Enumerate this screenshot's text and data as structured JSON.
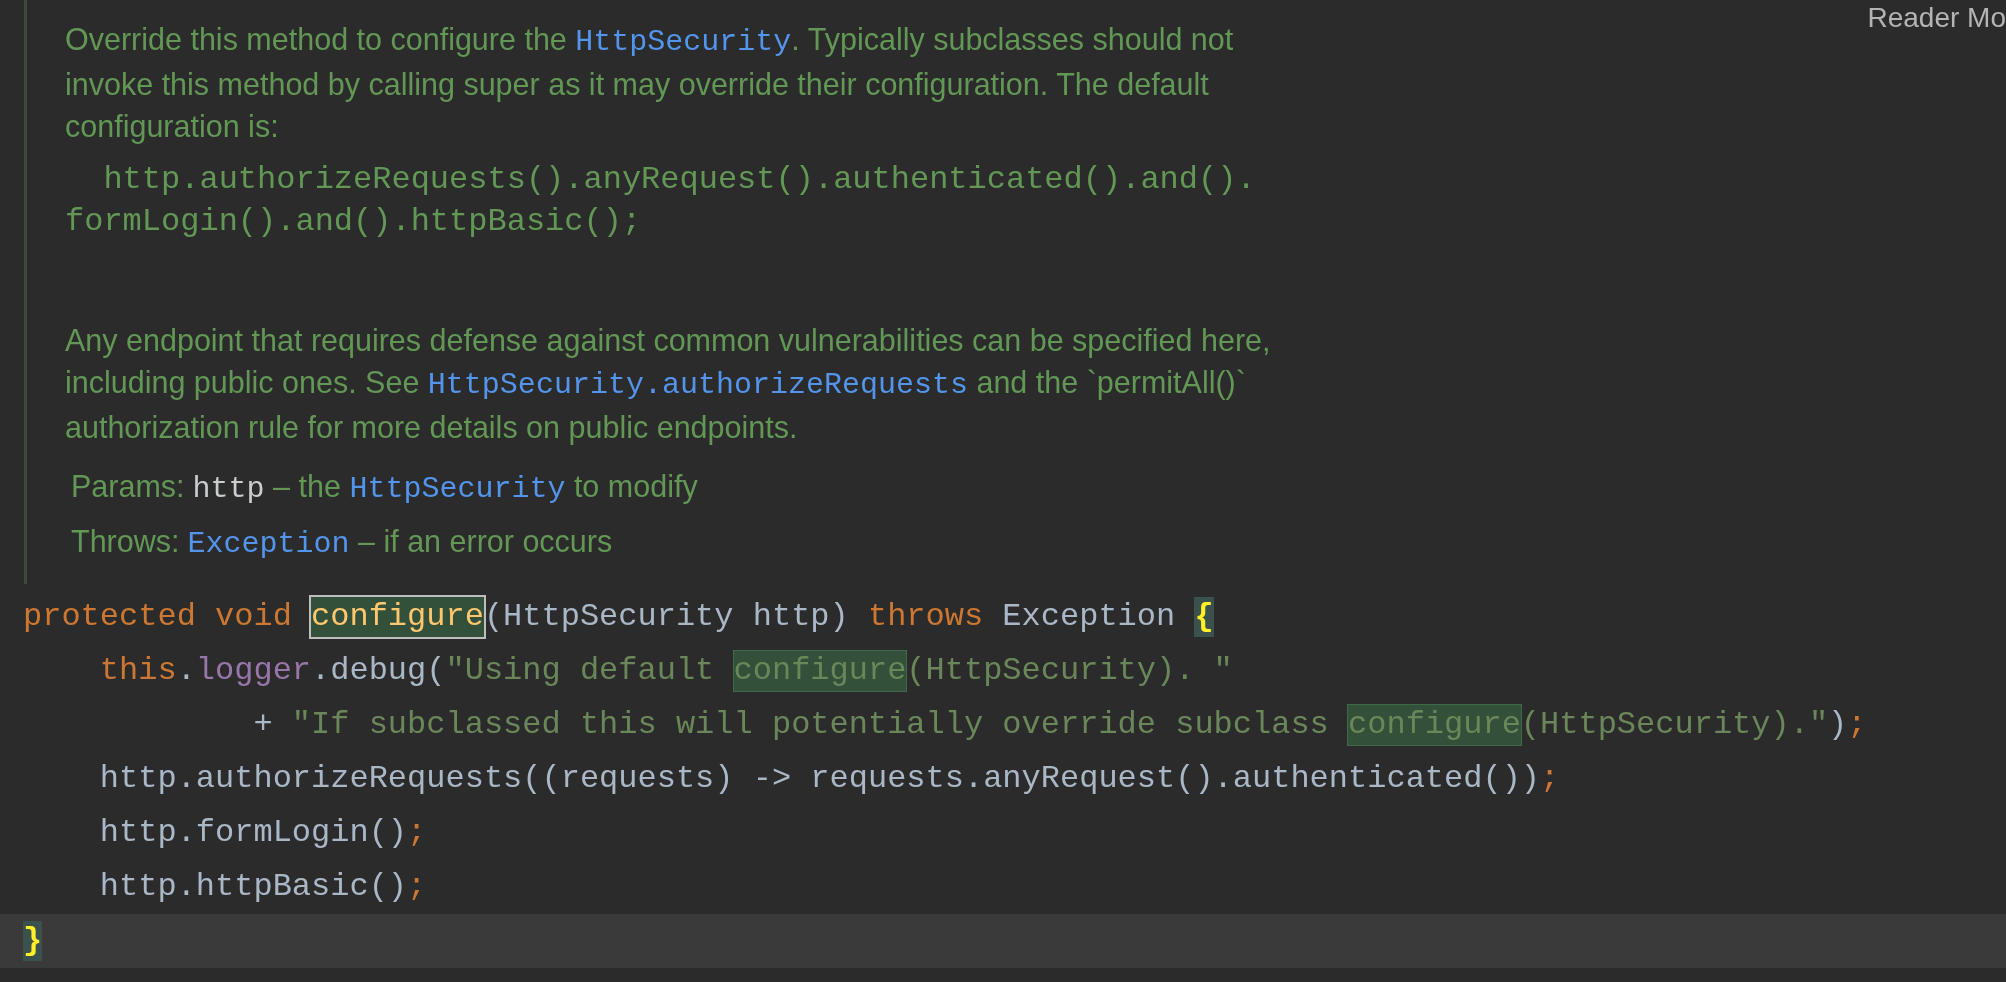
{
  "reader_mode": {
    "label": "Reader Mo"
  },
  "doc": {
    "paragraphs": [
      {
        "kind": "prose",
        "segments": [
          {
            "kind": "text",
            "text": "Override this method to configure the "
          },
          {
            "kind": "link",
            "text": "HttpSecurity"
          },
          {
            "kind": "text",
            "text": ". Typically subclasses should not invoke this method by calling super as it may override their configuration. The default configuration is:"
          }
        ]
      },
      {
        "kind": "code",
        "segments": [
          {
            "kind": "text",
            "text": "  http.authorizeRequests().anyRequest().authenticated().and().formLogin().and().httpBasic();"
          }
        ]
      },
      {
        "kind": "prose",
        "segments": [
          {
            "kind": "text",
            "text": "Any endpoint that requires defense against common vulnerabilities can be specified here, including public ones. See "
          },
          {
            "kind": "link",
            "text": "HttpSecurity.authorizeRequests"
          },
          {
            "kind": "text",
            "text": " and the `permitAll()` authorization rule for more details on public endpoints."
          }
        ]
      }
    ],
    "tags": [
      {
        "label": "Params:",
        "segments": [
          {
            "kind": "param",
            "text": "http"
          },
          {
            "kind": "text",
            "text": " – the "
          },
          {
            "kind": "link",
            "text": "HttpSecurity"
          },
          {
            "kind": "text",
            "text": " to modify"
          }
        ]
      },
      {
        "label": "Throws:",
        "segments": [
          {
            "kind": "link",
            "text": "Exception"
          },
          {
            "kind": "text",
            "text": " – if an error occurs"
          }
        ]
      }
    ]
  },
  "code_lines": [
    {
      "current": false,
      "tokens": [
        {
          "kind": "keyword",
          "text": "protected void "
        },
        {
          "kind": "decl-match",
          "text": "configure"
        },
        {
          "kind": "plain",
          "text": "(HttpSecurity http) "
        },
        {
          "kind": "keyword",
          "text": "throws "
        },
        {
          "kind": "plain",
          "text": "Exception "
        },
        {
          "kind": "brace-match",
          "text": "{"
        }
      ]
    },
    {
      "current": false,
      "tokens": [
        {
          "kind": "keyword",
          "text": "    this"
        },
        {
          "kind": "plain",
          "text": "."
        },
        {
          "kind": "field",
          "text": "logger"
        },
        {
          "kind": "plain",
          "text": ".debug("
        },
        {
          "kind": "string",
          "text": "\"Using default "
        },
        {
          "kind": "string-match",
          "text": "configure"
        },
        {
          "kind": "string",
          "text": "(HttpSecurity). \""
        }
      ]
    },
    {
      "current": false,
      "tokens": [
        {
          "kind": "plain",
          "text": "            + "
        },
        {
          "kind": "string",
          "text": "\"If subclassed this will potentially override subclass "
        },
        {
          "kind": "string-match",
          "text": "configure"
        },
        {
          "kind": "string",
          "text": "(HttpSecurity).\""
        },
        {
          "kind": "plain",
          "text": ")"
        },
        {
          "kind": "semi",
          "text": ";"
        }
      ]
    },
    {
      "current": false,
      "tokens": [
        {
          "kind": "plain",
          "text": "    http.authorizeRequests((requests) -> requests.anyRequest().authenticated())"
        },
        {
          "kind": "semi",
          "text": ";"
        }
      ]
    },
    {
      "current": false,
      "tokens": [
        {
          "kind": "plain",
          "text": "    http.formLogin()"
        },
        {
          "kind": "semi",
          "text": ";"
        }
      ]
    },
    {
      "current": false,
      "tokens": [
        {
          "kind": "plain",
          "text": "    http.httpBasic()"
        },
        {
          "kind": "semi",
          "text": ";"
        }
      ]
    },
    {
      "current": true,
      "tokens": [
        {
          "kind": "brace-match",
          "text": "}"
        }
      ]
    }
  ]
}
